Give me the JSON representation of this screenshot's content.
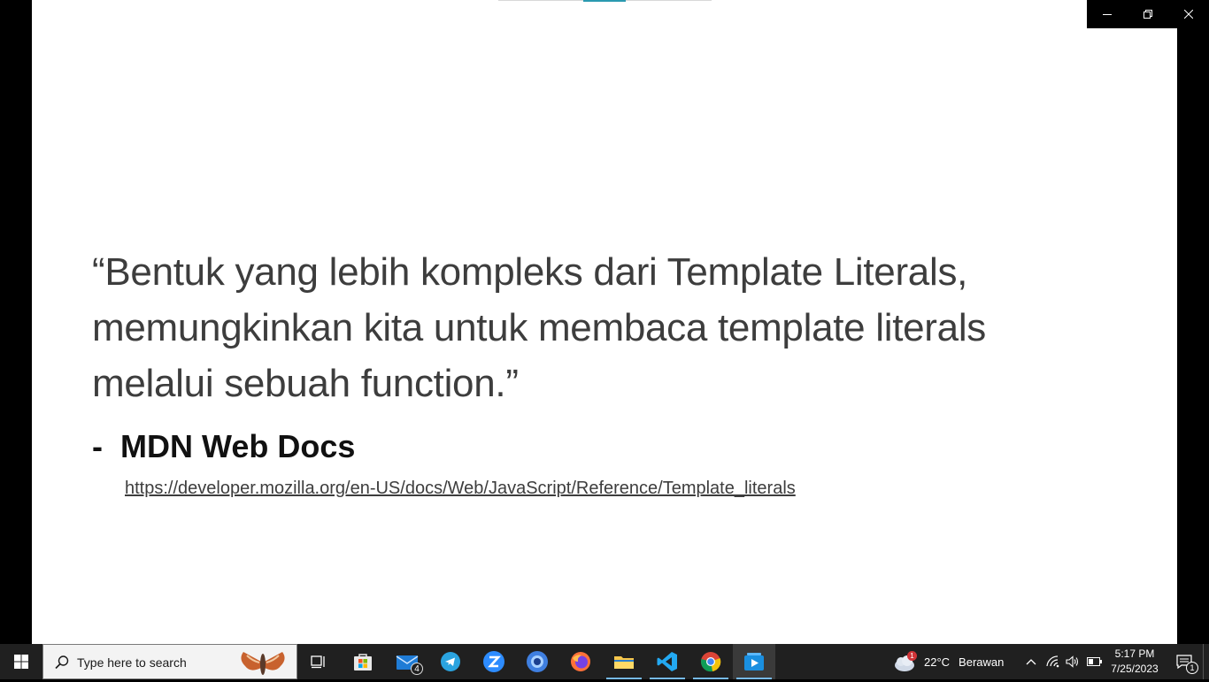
{
  "slide": {
    "quote": "“Bentuk yang lebih kompleks dari Template Literals,\nmemungkinkan kita untuk membaca template literals\nmelalui sebuah function.”",
    "attribution_dash": "-",
    "attribution": "MDN Web Docs",
    "source_url": "https://developer.mozilla.org/en-US/docs/Web/JavaScript/Reference/Template_literals"
  },
  "window_controls": [
    "minimize",
    "restore",
    "close"
  ],
  "taskbar": {
    "search_placeholder": "Type here to search",
    "apps": [
      {
        "name": "task-view",
        "icon": "task-view-icon"
      },
      {
        "name": "microsoft-store",
        "icon": "store-icon"
      },
      {
        "name": "mail",
        "icon": "mail-icon",
        "badge": "4"
      },
      {
        "name": "telegram",
        "icon": "telegram-icon"
      },
      {
        "name": "zoom",
        "icon": "zoom-icon"
      },
      {
        "name": "app-blue-circle",
        "icon": "circle-app-icon"
      },
      {
        "name": "firefox",
        "icon": "firefox-icon"
      },
      {
        "name": "file-explorer",
        "icon": "folder-icon"
      },
      {
        "name": "vscode",
        "icon": "vscode-icon"
      },
      {
        "name": "chrome",
        "icon": "chrome-icon"
      },
      {
        "name": "media-player",
        "icon": "media-player-icon"
      }
    ],
    "weather": {
      "temp": "22°C",
      "condition": "Berawan",
      "alert_count": "1"
    },
    "clock": {
      "time": "5:17 PM",
      "date": "7/25/2023"
    },
    "notification_count": "1"
  },
  "colors": {
    "taskbar_bg": "#202020",
    "accent": "#76b9ed",
    "slide_bg": "#ffffff"
  }
}
